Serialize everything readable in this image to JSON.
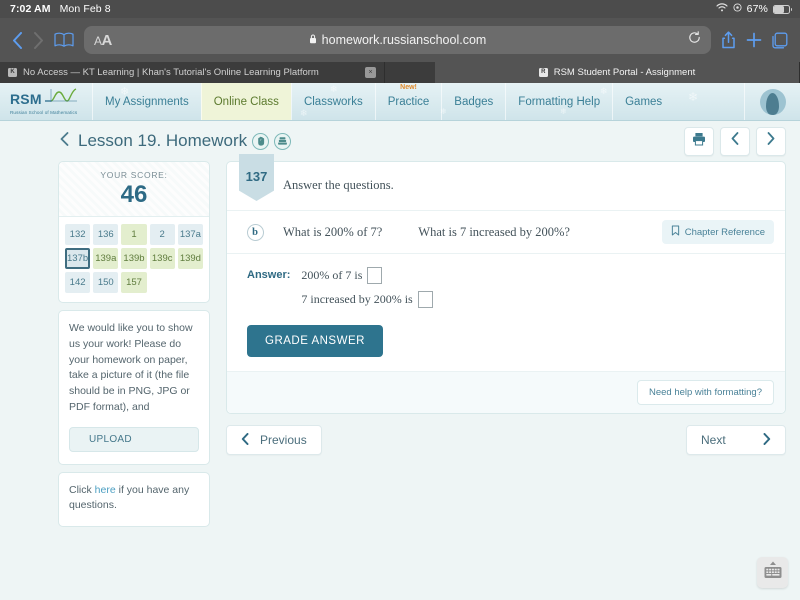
{
  "statusbar": {
    "time": "7:02 AM",
    "date": "Mon Feb 8",
    "battery_percent": "67%",
    "wifi_icon": "wifi-icon",
    "battery_icon": "battery-icon"
  },
  "browser": {
    "url": "homework.russianschool.com",
    "aa_label": "A",
    "aa_label_big": "A",
    "back_icon": "chevron-left-icon",
    "forward_icon": "chevron-right-icon",
    "bookmarks_icon": "book-icon",
    "lock_icon": "lock-icon",
    "reload_icon": "reload-icon",
    "share_icon": "share-icon",
    "newtab_icon": "plus-icon",
    "tabs_icon": "tab-overview-icon",
    "tabs": [
      {
        "title": "No Access — KT Learning | Khan's Tutorial's Online Learning Platform",
        "favicon": "K",
        "active": false,
        "close": "×"
      },
      {
        "title": "RSM Student Portal - Assignment",
        "favicon": "R",
        "active": true
      }
    ]
  },
  "topnav": {
    "logo_text": "RSM",
    "logo_subtitle": "Russian School of Mathematics",
    "items": [
      {
        "label": "My Assignments",
        "active": false
      },
      {
        "label": "Online Class",
        "active": true
      },
      {
        "label": "Classworks",
        "active": false
      },
      {
        "label": "Practice",
        "active": false,
        "badge": "New!"
      },
      {
        "label": "Badges",
        "active": false
      },
      {
        "label": "Formatting Help",
        "active": false
      },
      {
        "label": "Games",
        "active": false
      }
    ],
    "avatar_name": "avatar"
  },
  "lesson": {
    "title": "Lesson 19. Homework",
    "back_icon": "chevron-left-icon",
    "hand_icon": "hand-icon",
    "books_icon": "books-icon",
    "print_icon": "printer-icon",
    "prev_icon": "chevron-left-icon",
    "next_icon": "chevron-right-icon"
  },
  "score": {
    "label": "YOUR SCORE:",
    "value": "46",
    "grid": [
      {
        "label": "132",
        "state": "plain"
      },
      {
        "label": "136",
        "state": "plain"
      },
      {
        "label": "1",
        "state": "green"
      },
      {
        "label": "2",
        "state": "plain"
      },
      {
        "label": "137a",
        "state": "plain"
      },
      {
        "label": "137b",
        "state": "selected"
      },
      {
        "label": "139a",
        "state": "green"
      },
      {
        "label": "139b",
        "state": "green"
      },
      {
        "label": "139c",
        "state": "green"
      },
      {
        "label": "139d",
        "state": "green"
      },
      {
        "label": "142",
        "state": "plain"
      },
      {
        "label": "150",
        "state": "plain"
      },
      {
        "label": "157",
        "state": "green"
      },
      {
        "label": "",
        "state": "empty"
      },
      {
        "label": "",
        "state": "empty"
      }
    ]
  },
  "note": {
    "text": "We would like you to show us your work! Please do your homework on paper, take a picture of it (the file should be in PNG, JPG or PDF format), and",
    "upload_label": "UPLOAD"
  },
  "help": {
    "before": "Click ",
    "link": "here",
    "after": " if you have any questions."
  },
  "question": {
    "number": "137",
    "prompt": "Answer the questions.",
    "part_letter": "b",
    "part_1": "What is 200% of 7?",
    "part_2": "What is 7 increased by 200%?",
    "chapter_ref_label": "Chapter Reference",
    "bookmark_icon": "bookmark-icon",
    "answer_label": "Answer:",
    "answer_line_1": "200% of 7 is",
    "answer_line_2": "7 increased by 200% is",
    "answer_value_1": "",
    "answer_value_2": "",
    "grade_label": "GRADE ANSWER",
    "formatting_help_label": "Need help with formatting?"
  },
  "pager": {
    "previous_label": "Previous",
    "next_label": "Next",
    "prev_icon": "chevron-left-icon",
    "next_icon": "chevron-right-icon"
  },
  "keyboard": {
    "dismiss_icon": "keyboard-dismiss-icon"
  },
  "colors": {
    "brand_blue": "#2e748e",
    "nav_active_bg": "#eff4d8",
    "cell_green": "#e3eece",
    "badge_orange": "#e08b2e",
    "page_bg": "#eef5f5"
  }
}
